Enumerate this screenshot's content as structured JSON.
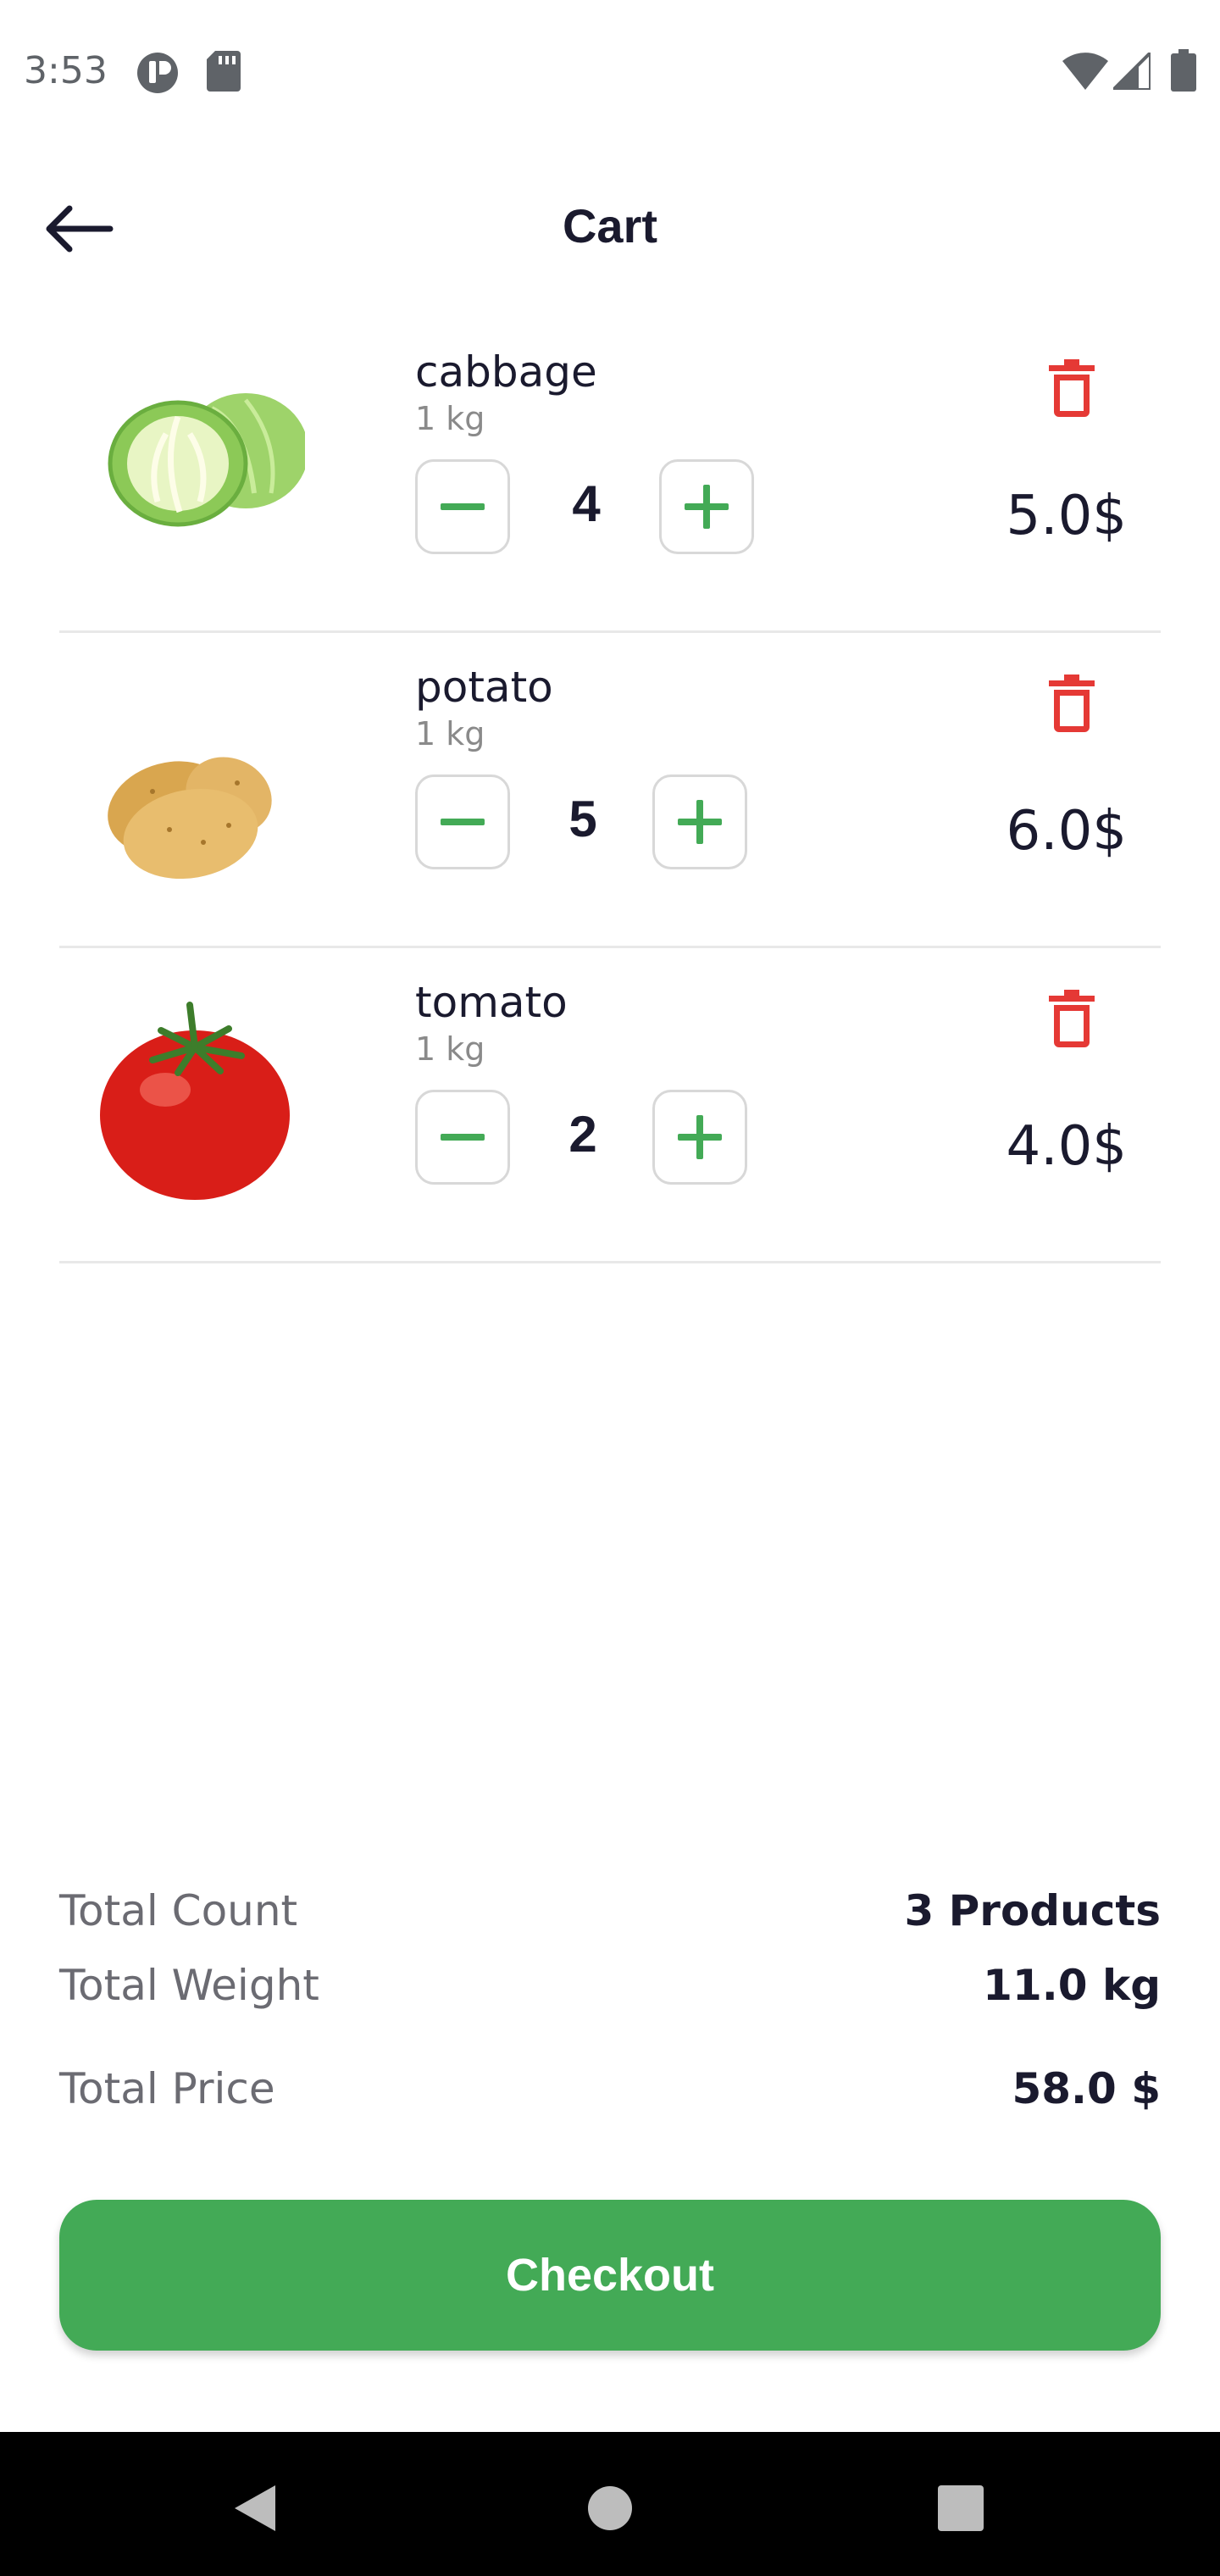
{
  "status_bar": {
    "time": "3:53",
    "icons": [
      "notification-icon",
      "sd-card-icon",
      "wifi-icon",
      "cellular-signal-icon",
      "battery-icon"
    ]
  },
  "header": {
    "title": "Cart",
    "back_icon": "arrow-back-icon"
  },
  "cart": {
    "items": [
      {
        "name": "cabbage",
        "unit": "1 kg",
        "quantity": "4",
        "price": "5.0$",
        "image": "cabbage-image"
      },
      {
        "name": "potato",
        "unit": "1 kg",
        "quantity": "5",
        "price": "6.0$",
        "image": "potato-image"
      },
      {
        "name": "tomato",
        "unit": "1 kg",
        "quantity": "2",
        "price": "4.0$",
        "image": "tomato-image"
      }
    ]
  },
  "summary": {
    "count_label": "Total Count",
    "count_value": "3 Products",
    "weight_label": "Total Weight",
    "weight_value": "11.0 kg",
    "price_label": "Total Price",
    "price_value": "58.0 $"
  },
  "checkout": {
    "label": "Checkout"
  },
  "colors": {
    "accent": "#43aa56",
    "delete": "#e53935",
    "text": "#1a1a2e",
    "muted": "#8a8a8a"
  },
  "nav_bar": {
    "icons": [
      "back-nav-icon",
      "home-nav-icon",
      "recents-nav-icon"
    ]
  }
}
